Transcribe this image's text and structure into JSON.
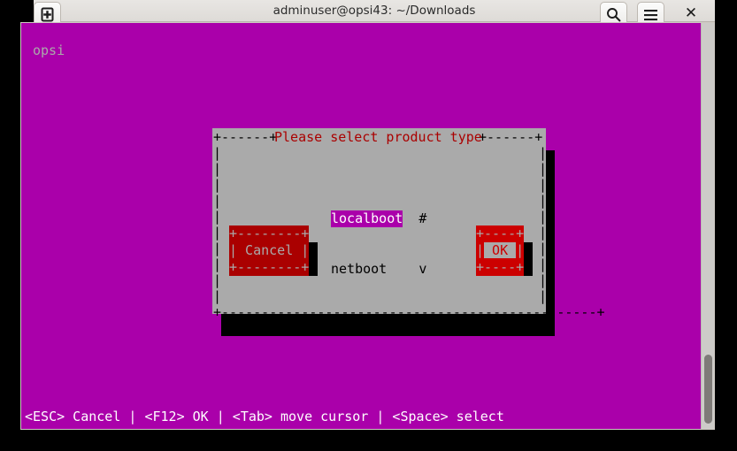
{
  "window": {
    "title": "adminuser@opsi43: ~/Downloads",
    "controls": {
      "new_tab": "new-tab-icon",
      "search": "search-icon",
      "menu": "hamburger-menu-icon",
      "close": "✕"
    }
  },
  "terminal": {
    "banner": "opsi",
    "status_line": "<ESC> Cancel | <F12> OK | <Tab> move cursor | <Space> select",
    "background_color": "#aa00aa",
    "foreground_color": "#aaaaaa"
  },
  "dialog": {
    "title": "Please select product type",
    "title_color": "#aa0000",
    "background_color": "#aaaaaa",
    "top_border": "+------+",
    "top_border_right": "+------+",
    "bottom_border": "+-----------------------------------------------+",
    "side_char": "|",
    "list": [
      {
        "label": "localboot",
        "mark": "#",
        "selected": true
      },
      {
        "label": "netboot",
        "mark": "v",
        "selected": false
      }
    ],
    "buttons": [
      {
        "name": "cancel",
        "label": "Cancel",
        "top_border": "+--------+",
        "body": "| Cancel |",
        "bottom_border": "+--------+",
        "focused": false,
        "color": "#aa0000"
      },
      {
        "name": "ok",
        "label": "OK",
        "top_border": "+----+",
        "body_left": "|",
        "body_label": " OK ",
        "body_right": "|",
        "bottom_border": "+----+",
        "focused": true,
        "color": "#cc0000"
      }
    ]
  },
  "scrollbar": {
    "name": "terminal-scrollbar",
    "thumb_position_pct": 82
  }
}
